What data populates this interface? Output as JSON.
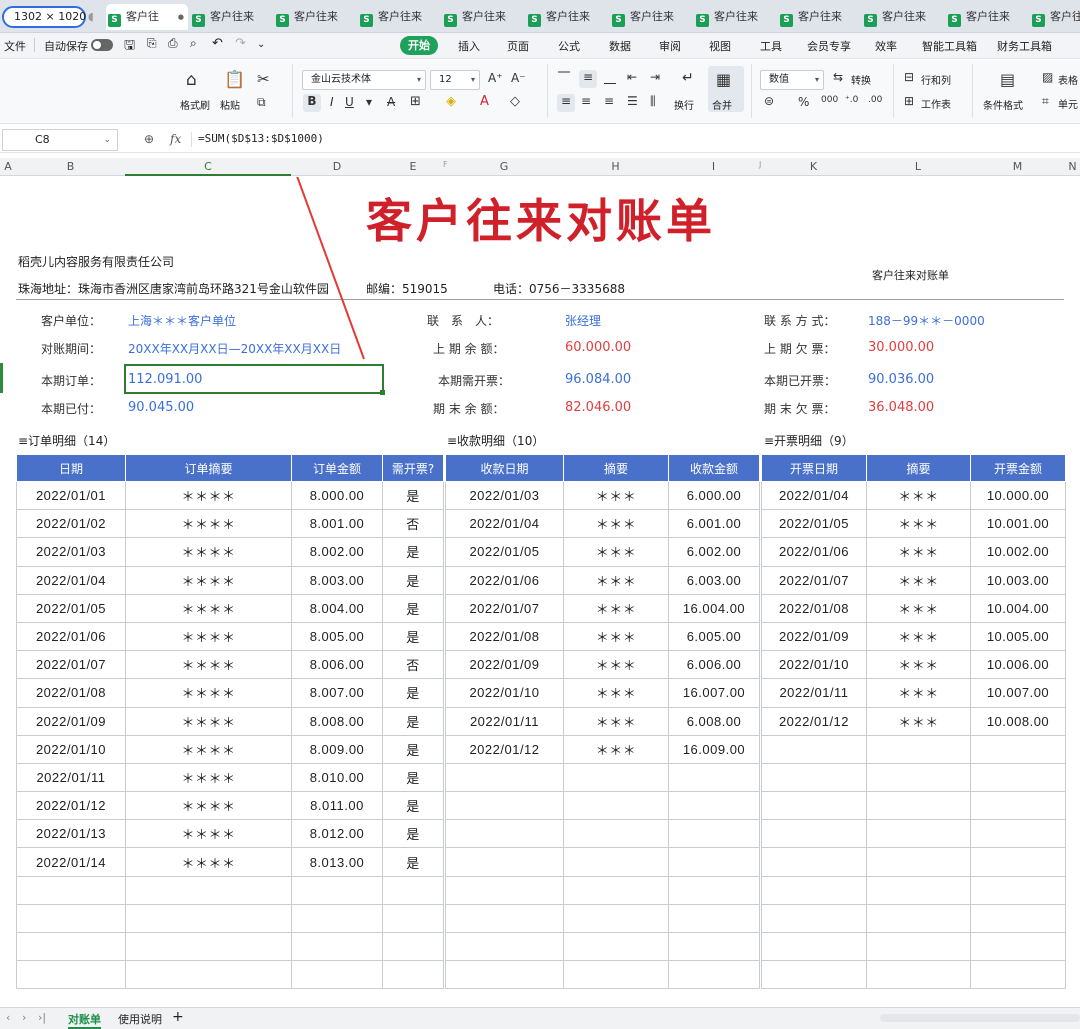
{
  "window": {
    "size_label": "1302 × 1020"
  },
  "doc_tabs": [
    {
      "label": "客户往"
    },
    {
      "label": "客户往来"
    },
    {
      "label": "客户往来"
    },
    {
      "label": "客户往来"
    },
    {
      "label": "客户往来"
    },
    {
      "label": "客户往来"
    },
    {
      "label": "客户往来"
    },
    {
      "label": "客户往来"
    },
    {
      "label": "客户往来"
    },
    {
      "label": "客户往来"
    },
    {
      "label": "客户往来"
    },
    {
      "label": "客户往来"
    }
  ],
  "menu": {
    "file": "文件",
    "autosave": "自动保存",
    "items": [
      "开始",
      "插入",
      "页面",
      "公式",
      "数据",
      "审阅",
      "视图",
      "工具",
      "会员专享",
      "效率",
      "智能工具箱",
      "财务工具箱"
    ]
  },
  "ribbon": {
    "format_painter": "格式刷",
    "paste": "粘贴",
    "font_name": "金山云技术体",
    "font_size": "12",
    "wrap": "换行",
    "merge": "合并",
    "number_format": "数值",
    "convert": "转换",
    "rows_cols": "行和列",
    "worksheet": "工作表",
    "cond_format": "条件格式",
    "table": "表格",
    "cell": "单元"
  },
  "formula_bar": {
    "cell_ref": "C8",
    "fx": "fx",
    "formula": "=SUM($D$13:$D$1000)"
  },
  "columns": [
    "A",
    "B",
    "C",
    "D",
    "E",
    "F",
    "G",
    "H",
    "I",
    "J",
    "K",
    "L",
    "M",
    "N"
  ],
  "sheet": {
    "title": "客户往来对账单",
    "company": "稻壳儿内容服务有限责任公司",
    "address": "珠海地址：珠海市香洲区唐家湾前岛环路321号金山软件园",
    "postcode": "邮编：519015",
    "phone": "电话：0756－3335688",
    "doc_name": "客户往来对账单",
    "info": {
      "customer_label": "客户单位：",
      "customer": "上海＊＊＊客户单位",
      "period_label": "对账期间：",
      "period": "20XX年XX月XX日—20XX年XX月XX日",
      "order_label": "本期订单：",
      "order": "112.091.00",
      "paid_label": "本期已付：",
      "paid": "90.045.00",
      "contact_label": "联　系　人：",
      "contact": "张经理",
      "prev_balance_label": "上 期 余 额：",
      "prev_balance": "60.000.00",
      "need_invoice_label": "本期需开票：",
      "need_invoice": "96.084.00",
      "end_balance_label": "期 末 余 额：",
      "end_balance": "82.046.00",
      "method_label": "联 系 方 式：",
      "method": "188－99＊＊－0000",
      "prev_owed_label": "上 期 欠 票：",
      "prev_owed": "30.000.00",
      "invoiced_label": "本期已开票：",
      "invoiced": "90.036.00",
      "end_owed_label": "期 末 欠 票：",
      "end_owed": "36.048.00"
    },
    "orders": {
      "heading": "≡订单明细（14）",
      "headers": [
        "日期",
        "订单摘要",
        "订单金额",
        "需开票?"
      ],
      "rows": [
        [
          "2022/01/01",
          "＊＊＊＊",
          "8.000.00",
          "是"
        ],
        [
          "2022/01/02",
          "＊＊＊＊",
          "8.001.00",
          "否"
        ],
        [
          "2022/01/03",
          "＊＊＊＊",
          "8.002.00",
          "是"
        ],
        [
          "2022/01/04",
          "＊＊＊＊",
          "8.003.00",
          "是"
        ],
        [
          "2022/01/05",
          "＊＊＊＊",
          "8.004.00",
          "是"
        ],
        [
          "2022/01/06",
          "＊＊＊＊",
          "8.005.00",
          "是"
        ],
        [
          "2022/01/07",
          "＊＊＊＊",
          "8.006.00",
          "否"
        ],
        [
          "2022/01/08",
          "＊＊＊＊",
          "8.007.00",
          "是"
        ],
        [
          "2022/01/09",
          "＊＊＊＊",
          "8.008.00",
          "是"
        ],
        [
          "2022/01/10",
          "＊＊＊＊",
          "8.009.00",
          "是"
        ],
        [
          "2022/01/11",
          "＊＊＊＊",
          "8.010.00",
          "是"
        ],
        [
          "2022/01/12",
          "＊＊＊＊",
          "8.011.00",
          "是"
        ],
        [
          "2022/01/13",
          "＊＊＊＊",
          "8.012.00",
          "是"
        ],
        [
          "2022/01/14",
          "＊＊＊＊",
          "8.013.00",
          "是"
        ]
      ]
    },
    "receipts": {
      "heading": "≡收款明细（10）",
      "headers": [
        "收款日期",
        "摘要",
        "收款金额"
      ],
      "rows": [
        [
          "2022/01/03",
          "＊＊＊",
          "6.000.00"
        ],
        [
          "2022/01/04",
          "＊＊＊",
          "6.001.00"
        ],
        [
          "2022/01/05",
          "＊＊＊",
          "6.002.00"
        ],
        [
          "2022/01/06",
          "＊＊＊",
          "6.003.00"
        ],
        [
          "2022/01/07",
          "＊＊＊",
          "16.004.00"
        ],
        [
          "2022/01/08",
          "＊＊＊",
          "6.005.00"
        ],
        [
          "2022/01/09",
          "＊＊＊",
          "6.006.00"
        ],
        [
          "2022/01/10",
          "＊＊＊",
          "16.007.00"
        ],
        [
          "2022/01/11",
          "＊＊＊",
          "6.008.00"
        ],
        [
          "2022/01/12",
          "＊＊＊",
          "16.009.00"
        ]
      ]
    },
    "invoices": {
      "heading": "≡开票明细（9）",
      "headers": [
        "开票日期",
        "摘要",
        "开票金额"
      ],
      "rows": [
        [
          "2022/01/04",
          "＊＊＊",
          "10.000.00"
        ],
        [
          "2022/01/05",
          "＊＊＊",
          "10.001.00"
        ],
        [
          "2022/01/06",
          "＊＊＊",
          "10.002.00"
        ],
        [
          "2022/01/07",
          "＊＊＊",
          "10.003.00"
        ],
        [
          "2022/01/08",
          "＊＊＊",
          "10.004.00"
        ],
        [
          "2022/01/09",
          "＊＊＊",
          "10.005.00"
        ],
        [
          "2022/01/10",
          "＊＊＊",
          "10.006.00"
        ],
        [
          "2022/01/11",
          "＊＊＊",
          "10.007.00"
        ],
        [
          "2022/01/12",
          "＊＊＊",
          "10.008.00"
        ]
      ]
    }
  },
  "sheet_tabs": [
    {
      "label": "对账单"
    },
    {
      "label": "使用说明"
    }
  ],
  "colors": {
    "accent_green": "#1ea15a",
    "header_blue": "#4a71c9",
    "title_red": "#d0202a",
    "value_blue": "#3b6fd8",
    "value_red": "#e03e3e"
  }
}
